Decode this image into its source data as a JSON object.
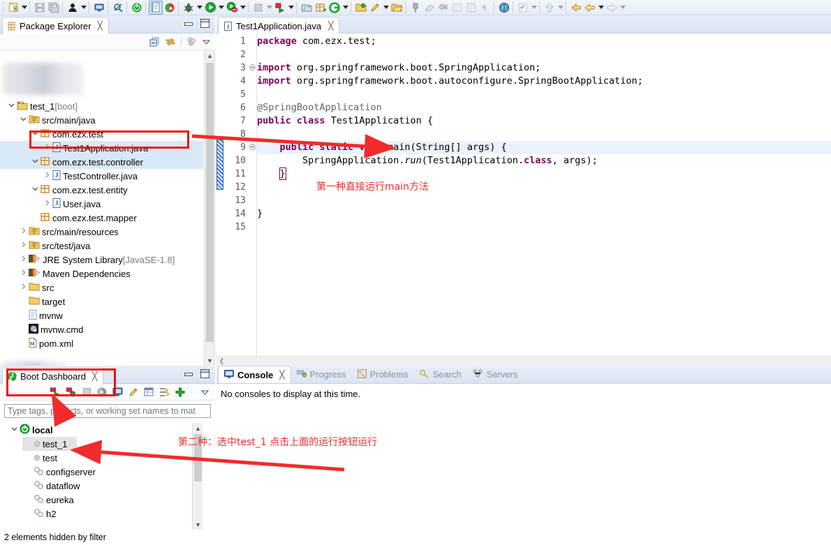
{
  "toolbar": {
    "groups": [
      {
        "items": [
          {
            "name": "new-wizard-icon",
            "type": "icon",
            "glyph": "new"
          },
          {
            "name": "new-wizard-dropdown",
            "type": "arrow"
          }
        ]
      },
      {
        "items": [
          {
            "name": "save-icon",
            "type": "icon",
            "glyph": "save-dim"
          },
          {
            "name": "save-all-icon",
            "type": "icon",
            "glyph": "saveall-dim"
          }
        ]
      },
      {
        "items": [
          {
            "name": "print-icon",
            "type": "icon",
            "glyph": "person"
          },
          {
            "name": "print-dropdown",
            "type": "arrow"
          }
        ]
      },
      {
        "items": [
          {
            "name": "open-console-icon",
            "type": "icon",
            "glyph": "monitor"
          }
        ]
      },
      {
        "items": [
          {
            "name": "skip-breakpoints-icon",
            "type": "icon",
            "glyph": "pin"
          }
        ]
      },
      {
        "items": [
          {
            "name": "boot-restart-icon",
            "type": "icon",
            "glyph": "power-green"
          }
        ]
      },
      {
        "items": [
          {
            "name": "new-java-class-icon",
            "type": "icon",
            "glyph": "notes-active"
          },
          {
            "name": "spring-icon",
            "type": "icon",
            "glyph": "spring-leaf"
          }
        ]
      },
      {
        "items": [
          {
            "name": "debug-icon",
            "type": "icon",
            "glyph": "bug"
          },
          {
            "name": "debug-dropdown",
            "type": "arrow"
          }
        ]
      },
      {
        "items": [
          {
            "name": "run-icon",
            "type": "icon",
            "glyph": "play-green"
          },
          {
            "name": "run-dropdown",
            "type": "arrow"
          }
        ]
      },
      {
        "items": [
          {
            "name": "run-external-tools-icon",
            "type": "icon",
            "glyph": "play-red-tool"
          },
          {
            "name": "external-tools-dropdown",
            "type": "arrow"
          }
        ]
      },
      {
        "items": [
          {
            "name": "stop-icon",
            "type": "icon",
            "glyph": "stop-dim"
          },
          {
            "name": "stop-dropdown",
            "type": "arrow",
            "dim": true
          }
        ]
      },
      {
        "items": [
          {
            "name": "run-last-icon",
            "type": "icon",
            "glyph": "run-last"
          },
          {
            "name": "run-last-dropdown",
            "type": "arrow"
          }
        ]
      },
      {
        "items": [
          {
            "name": "new-java-project-icon",
            "type": "icon",
            "glyph": "proj-java"
          },
          {
            "name": "new-package-icon",
            "type": "icon",
            "glyph": "pkg-new"
          },
          {
            "name": "coverage-icon",
            "type": "icon",
            "glyph": "coverage-green"
          },
          {
            "name": "coverage-dropdown",
            "type": "arrow"
          }
        ]
      },
      {
        "items": [
          {
            "name": "open-type-icon",
            "type": "icon",
            "glyph": "open-folder-y"
          },
          {
            "name": "open-task-icon",
            "type": "icon",
            "glyph": "open-folder-g"
          },
          {
            "name": "open-resource-icon",
            "type": "icon",
            "glyph": "open-folder-y2"
          },
          {
            "name": "search-pencil-icon",
            "type": "icon",
            "glyph": "pencil-y"
          },
          {
            "name": "search-dropdown",
            "type": "arrow"
          }
        ]
      },
      {
        "items": [
          {
            "name": "open-search-icon",
            "type": "icon",
            "glyph": "folder-open-y"
          }
        ]
      },
      {
        "items": [
          {
            "name": "next-annotation-icon",
            "type": "icon",
            "glyph": "marker-dim"
          },
          {
            "name": "prev-annotation-icon",
            "type": "icon",
            "glyph": "eraser-dim"
          },
          {
            "name": "toggle-mark-icon",
            "type": "icon",
            "glyph": "bubble-dim"
          },
          {
            "name": "toggle-block-icon",
            "type": "icon",
            "glyph": "block-dim"
          },
          {
            "name": "show-whitespace-icon",
            "type": "icon",
            "glyph": "lines-dim"
          },
          {
            "name": "pilcrow-icon",
            "type": "icon",
            "glyph": "pilcrow-dim"
          }
        ]
      },
      {
        "items": [
          {
            "name": "open-browser-icon",
            "type": "icon",
            "glyph": "globe"
          }
        ]
      },
      {
        "items": [
          {
            "name": "quick-access-icon",
            "type": "icon",
            "glyph": "checklist-dim"
          },
          {
            "name": "quick-access-dropdown",
            "type": "arrow",
            "dim": true
          }
        ]
      },
      {
        "items": [
          {
            "name": "up-navigate-icon",
            "type": "icon",
            "glyph": "arrow-up-dim"
          },
          {
            "name": "up-dropdown",
            "type": "arrow",
            "dim": true
          }
        ]
      },
      {
        "items": [
          {
            "name": "back-history-icon",
            "type": "icon",
            "glyph": "arrow-left-y1"
          },
          {
            "name": "back-icon",
            "type": "icon",
            "glyph": "arrow-left-y2"
          },
          {
            "name": "back-dropdown",
            "type": "arrow"
          }
        ]
      },
      {
        "items": [
          {
            "name": "forward-icon",
            "type": "icon",
            "glyph": "arrow-right-dim"
          },
          {
            "name": "forward-dropdown",
            "type": "arrow",
            "dim": true
          }
        ]
      }
    ]
  },
  "package_explorer": {
    "tab_label": "Package Explorer",
    "close_glyph": "╳",
    "toolbar_icons": [
      "collapse-all-icon",
      "link-with-editor-icon",
      "view-menu-filter-icon",
      "view-menu-icon"
    ],
    "tree": [
      {
        "indent": 0,
        "twist": "⌄",
        "icon": "project",
        "label": "test_1",
        "suffix": " [boot]",
        "selected": false
      },
      {
        "indent": 1,
        "twist": "⌄",
        "icon": "pkgroot",
        "label": "src/main/java",
        "suffix": "",
        "selected": false
      },
      {
        "indent": 2,
        "twist": "⌄",
        "icon": "pkg",
        "label": "com.ezx.test",
        "suffix": "",
        "selected": false
      },
      {
        "indent": 3,
        "twist": "›",
        "icon": "java",
        "label": "Test1Application.java",
        "suffix": "",
        "selected": true
      },
      {
        "indent": 2,
        "twist": "⌄",
        "icon": "pkg",
        "label": "com.ezx.test.controller",
        "suffix": "",
        "selected": true
      },
      {
        "indent": 3,
        "twist": "›",
        "icon": "java",
        "label": "TestController.java",
        "suffix": "",
        "selected": false
      },
      {
        "indent": 2,
        "twist": "⌄",
        "icon": "pkg",
        "label": "com.ezx.test.entity",
        "suffix": "",
        "selected": false
      },
      {
        "indent": 3,
        "twist": "›",
        "icon": "java",
        "label": "User.java",
        "suffix": "",
        "selected": false
      },
      {
        "indent": 2,
        "twist": "",
        "icon": "pkg-empty",
        "label": "com.ezx.test.mapper",
        "suffix": "",
        "selected": false
      },
      {
        "indent": 1,
        "twist": "›",
        "icon": "pkgroot",
        "label": "src/main/resources",
        "suffix": "",
        "selected": false
      },
      {
        "indent": 1,
        "twist": "›",
        "icon": "pkgroot",
        "label": "src/test/java",
        "suffix": "",
        "selected": false
      },
      {
        "indent": 1,
        "twist": "›",
        "icon": "lib",
        "label": "JRE System Library",
        "suffix": " [JavaSE-1.8]",
        "selected": false
      },
      {
        "indent": 1,
        "twist": "›",
        "icon": "lib",
        "label": "Maven Dependencies",
        "suffix": "",
        "selected": false
      },
      {
        "indent": 1,
        "twist": "›",
        "icon": "folder",
        "label": "src",
        "suffix": "",
        "selected": false
      },
      {
        "indent": 1,
        "twist": "",
        "icon": "folder",
        "label": "target",
        "suffix": "",
        "selected": false
      },
      {
        "indent": 1,
        "twist": "",
        "icon": "file",
        "label": "mvnw",
        "suffix": "",
        "selected": false
      },
      {
        "indent": 1,
        "twist": "",
        "icon": "cmd",
        "label": "mvnw.cmd",
        "suffix": "",
        "selected": false
      },
      {
        "indent": 1,
        "twist": "",
        "icon": "xml",
        "label": "pom.xml",
        "suffix": "",
        "selected": false
      }
    ]
  },
  "boot_dashboard": {
    "tab_label": "Boot Dashboard",
    "close_glyph": "╳",
    "toolbar_icons": [
      "start-restart-icon",
      "debug-restart-icon",
      "stop-icon",
      "open-dashboard-icon",
      "open-console-icon",
      "edit-icon",
      "open-properties-icon",
      "open-ngrok-icon",
      "add-icon",
      "view-menu-icon"
    ],
    "filter_placeholder": "Type tags, projects, or working set names to mat",
    "tree": [
      {
        "indent": 0,
        "twist": "⌄",
        "icon": "boot",
        "label": "local",
        "bold": true,
        "selected": false
      },
      {
        "indent": 1,
        "twist": "",
        "icon": "dot",
        "label": "test_1",
        "bold": false,
        "selected": true
      },
      {
        "indent": 1,
        "twist": "",
        "icon": "dot",
        "label": "test",
        "bold": false,
        "selected": false
      },
      {
        "indent": 1,
        "twist": "",
        "icon": "gear",
        "label": "configserver",
        "bold": false,
        "selected": false
      },
      {
        "indent": 1,
        "twist": "",
        "icon": "gear",
        "label": "dataflow",
        "bold": false,
        "selected": false
      },
      {
        "indent": 1,
        "twist": "",
        "icon": "gear",
        "label": "eureka",
        "bold": false,
        "selected": false
      },
      {
        "indent": 1,
        "twist": "",
        "icon": "gear",
        "label": "h2",
        "bold": false,
        "selected": false
      }
    ],
    "status_text": "2 elements hidden by filter"
  },
  "editor": {
    "tab_label": "Test1Application.java",
    "close_glyph": "╳",
    "file_icon": "java-file-icon",
    "lines": [
      {
        "n": "1",
        "fold": false,
        "hl": false,
        "html": "<span class=\"kw\">package</span> com.ezx.test;"
      },
      {
        "n": "2",
        "fold": false,
        "hl": false,
        "html": ""
      },
      {
        "n": "3",
        "fold": true,
        "hl": false,
        "html": "<span class=\"kw\">import</span> org.springframework.boot.SpringApplication;"
      },
      {
        "n": "4",
        "fold": false,
        "hl": false,
        "html": "<span class=\"kw\">import</span> org.springframework.boot.autoconfigure.SpringBootApplication;"
      },
      {
        "n": "5",
        "fold": false,
        "hl": false,
        "html": ""
      },
      {
        "n": "6",
        "fold": false,
        "hl": false,
        "html": "<span class=\"ann\">@SpringBootApplication</span>"
      },
      {
        "n": "7",
        "fold": false,
        "hl": false,
        "html": "<span class=\"kw\">public class</span> Test1Application {"
      },
      {
        "n": "8",
        "fold": false,
        "hl": false,
        "html": ""
      },
      {
        "n": "9",
        "fold": true,
        "hl": true,
        "html": "    <span class=\"kw\">public static void</span> main(String[] args) {"
      },
      {
        "n": "10",
        "fold": false,
        "hl": false,
        "html": "        SpringApplication.<span class=\"static-it\">run</span>(Test1Application.<span class=\"kw\">class</span>, args);"
      },
      {
        "n": "11",
        "fold": false,
        "hl": false,
        "html": "    <span class=\"brace-box\">}</span>"
      },
      {
        "n": "12",
        "fold": false,
        "hl": false,
        "html": ""
      },
      {
        "n": "13",
        "fold": false,
        "hl": false,
        "html": ""
      },
      {
        "n": "14",
        "fold": false,
        "hl": false,
        "html": "}"
      },
      {
        "n": "15",
        "fold": false,
        "hl": false,
        "html": ""
      }
    ]
  },
  "console": {
    "tabs": [
      {
        "label": "Console",
        "icon": "console-icon",
        "active": true
      },
      {
        "label": "Progress",
        "icon": "progress-icon",
        "active": false
      },
      {
        "label": "Problems",
        "icon": "problems-icon",
        "active": false
      },
      {
        "label": "Search",
        "icon": "search-icon",
        "active": false
      },
      {
        "label": "Servers",
        "icon": "servers-icon",
        "active": false
      }
    ],
    "body_text": "No consoles to display at this time."
  },
  "annotations": {
    "note1": "第一种直接运行main方法",
    "note2": "第二种：选中test_1 点击上面的运行按钮运行",
    "highlight_color": "#ee1111"
  }
}
